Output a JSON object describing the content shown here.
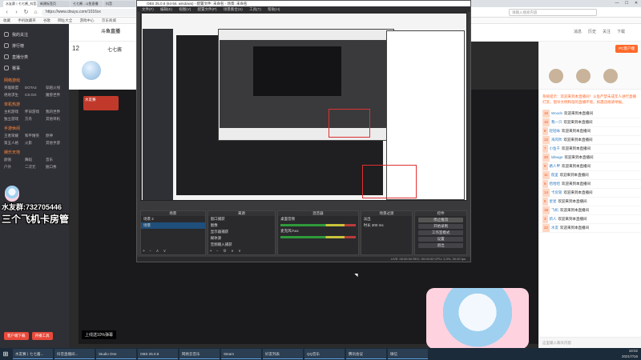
{
  "browser": {
    "tabs": [
      "水友赛丨七七酱_抖音...",
      "新建标签页",
      "七七酱 - 斗鱼直播",
      "抖音"
    ],
    "url": "https://www.douyu.com/1016xx",
    "search_placeholder": "请输入搜索内容",
    "bookmarks": [
      "收藏",
      "手机收藏夹",
      "谷歌",
      "网址大全",
      "游戏中心",
      "京东商城"
    ]
  },
  "site": {
    "logo": "斗鱼直播",
    "header_items": [
      "消息",
      "历史",
      "关注",
      "下载"
    ],
    "sidebar": {
      "items": [
        "我的关注",
        "排行榜",
        "直播分类",
        "赛事"
      ],
      "sections": [
        {
          "title": "网络游戏",
          "items": [
            "英雄联盟",
            "DOTA2",
            "穿越火线",
            "绝地求生",
            "CS:GO",
            "魔兽世界"
          ]
        },
        {
          "title": "单机热游",
          "items": [
            "主机游戏",
            "怀旧游戏",
            "我的世界",
            "独立游戏",
            "方舟",
            "其他单机"
          ]
        },
        {
          "title": "手游休闲",
          "items": [
            "王者荣耀",
            "和平精英",
            "原神",
            "第五人格",
            "火影",
            "其他手游"
          ]
        },
        {
          "title": "娱乐天地",
          "items": [
            "颜值",
            "舞蹈",
            "音乐",
            "户外",
            "二次元",
            "脱口秀"
          ]
        }
      ],
      "bottom_buttons": [
        "客户端下载",
        "开播工具"
      ]
    },
    "streamer": {
      "count": "12",
      "name": "七七酱"
    },
    "player_badge": "水友赛",
    "player_notice": "上线送10%弹幕",
    "overlay": {
      "line1": "水友群:732705446",
      "line2": "三个飞机卡房管"
    }
  },
  "obs": {
    "title": "OBS 25.0.8 (64-bit, windows) - 配置文件: 未命名 - 场景: 未命名",
    "menu": [
      "文件(F)",
      "编辑(E)",
      "视图(V)",
      "配置文件(P)",
      "场景集合(S)",
      "工具(T)",
      "帮助(H)"
    ],
    "docks": {
      "scenes": {
        "title": "场景",
        "items": [
          "场景 2",
          "场景"
        ]
      },
      "sources": {
        "title": "来源",
        "items": [
          "窗口捕获",
          "图像",
          "显示器捕获",
          "媒体源",
          "音频输入捕获",
          "图像"
        ]
      },
      "mixer": {
        "title": "混音器",
        "channels": [
          "桌面音频",
          "麦克风/Aux"
        ]
      },
      "transitions": {
        "title": "场景过渡",
        "fade": "淡出",
        "duration_label": "时长",
        "duration": "300 ms"
      },
      "controls": {
        "title": "控件",
        "buttons": [
          "停止推流",
          "开始录制",
          "工作室模式",
          "设置",
          "退出"
        ]
      }
    },
    "status": "LIVE: 00:00:00  REC: 00:00:00  CPU: 3.3%, 30.00 fps"
  },
  "chat": {
    "pc_button": "PC客户端",
    "notice": "系统提示：欢迎来到本直播间！斗鱼严禁未成年人进行直播打赏，倡导文明和谐的直播环境，如遇违规请举报。",
    "messages": [
      {
        "lv": "15",
        "name": "Woods",
        "text": "欢迎来到本直播间"
      },
      {
        "lv": "10",
        "name": "我一只",
        "text": "欢迎来到本直播间"
      },
      {
        "lv": "8",
        "name": "轻轻咏",
        "text": "欢迎来到本直播间"
      },
      {
        "lv": "12",
        "name": "海风吹",
        "text": "欢迎来到本直播间"
      },
      {
        "lv": "7",
        "name": "小鱼干",
        "text": "欢迎来到本直播间"
      },
      {
        "lv": "20",
        "name": "ldleage",
        "text": "欢迎来到本直播间"
      },
      {
        "lv": "9",
        "name": "路人甲",
        "text": "欢迎来到本直播间"
      },
      {
        "lv": "11",
        "name": "夜里",
        "text": "欢迎来到本直播间"
      },
      {
        "lv": "6",
        "name": "哈哈哈",
        "text": "欢迎来到本直播间"
      },
      {
        "lv": "14",
        "name": "卡房管",
        "text": "欢迎来到本直播间"
      },
      {
        "lv": "5",
        "name": "星星",
        "text": "欢迎来到本直播间"
      },
      {
        "lv": "18",
        "name": "飞机",
        "text": "欢迎来到本直播间"
      },
      {
        "lv": "3",
        "name": "新人",
        "text": "欢迎来到本直播间"
      },
      {
        "lv": "22",
        "name": "水友",
        "text": "欢迎来到本直播间"
      }
    ],
    "input_placeholder": "这里输入聊天内容"
  },
  "taskbar": {
    "items": [
      "水友赛丨七七酱...",
      "抖音直播间...",
      "Studio One",
      "OBS 25.0.8",
      "网易云音乐",
      "Steam",
      "好友列表",
      "QQ音乐",
      "腾讯会议",
      "微信"
    ],
    "time": "18:02",
    "date": "2021/7/16"
  }
}
